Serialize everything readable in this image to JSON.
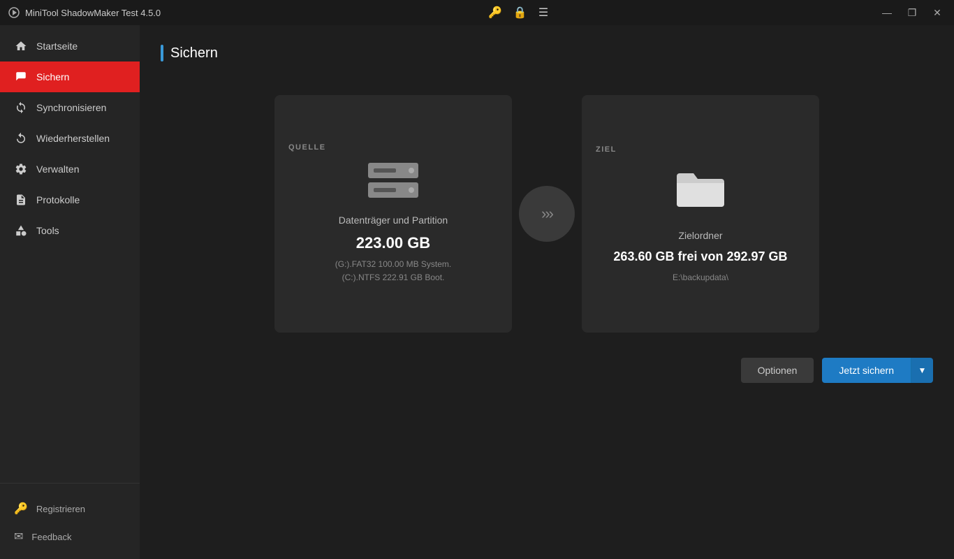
{
  "titlebar": {
    "title": "MiniTool ShadowMaker Test 4.5.0",
    "icons": {
      "key": "🔑",
      "lock": "🔒",
      "menu": "☰"
    },
    "controls": {
      "minimize": "—",
      "restore": "❐",
      "close": "✕"
    }
  },
  "sidebar": {
    "nav_items": [
      {
        "id": "startseite",
        "label": "Startseite",
        "active": false
      },
      {
        "id": "sichern",
        "label": "Sichern",
        "active": true
      },
      {
        "id": "synchronisieren",
        "label": "Synchronisieren",
        "active": false
      },
      {
        "id": "wiederherstellen",
        "label": "Wiederherstellen",
        "active": false
      },
      {
        "id": "verwalten",
        "label": "Verwalten",
        "active": false
      },
      {
        "id": "protokolle",
        "label": "Protokolle",
        "active": false
      },
      {
        "id": "tools",
        "label": "Tools",
        "active": false
      }
    ],
    "bottom_items": [
      {
        "id": "registrieren",
        "label": "Registrieren"
      },
      {
        "id": "feedback",
        "label": "Feedback"
      }
    ]
  },
  "content": {
    "page_title": "Sichern",
    "source_card": {
      "label": "QUELLE",
      "icon_type": "disk",
      "name": "Datenträger und Partition",
      "size": "223.00 GB",
      "detail_line1": "(G:).FAT32 100.00 MB System.",
      "detail_line2": "(C:).NTFS 222.91 GB Boot."
    },
    "target_card": {
      "label": "ZIEL",
      "icon_type": "folder",
      "name": "Zielordner",
      "free": "263.60 GB frei von 292.97 GB",
      "path": "E:\\backupdata\\"
    },
    "arrow": ">>>",
    "buttons": {
      "options": "Optionen",
      "backup": "Jetzt sichern",
      "dropdown": "▼"
    }
  }
}
